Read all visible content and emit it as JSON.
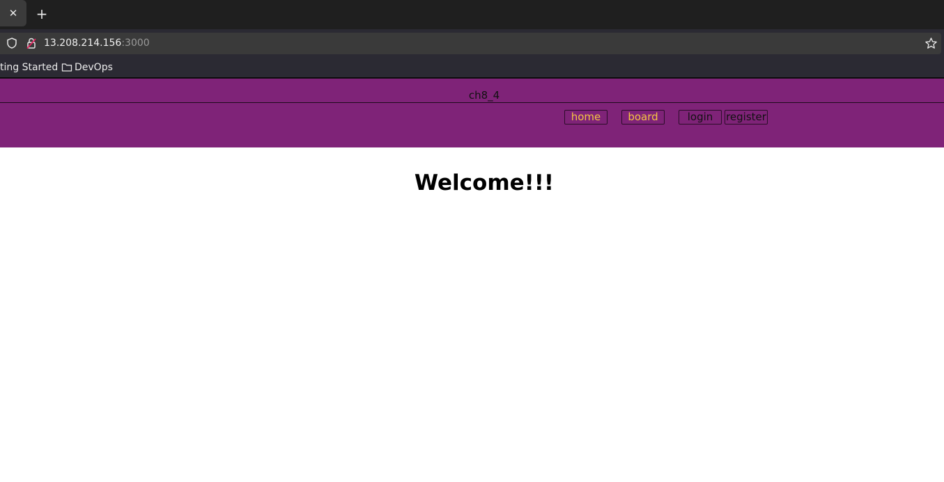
{
  "browser": {
    "tab_close_glyph": "✕",
    "new_tab_glyph": "+",
    "url_host": "13.208.214.156",
    "url_port": ":3000",
    "bookmarks": [
      {
        "label": "ting Started",
        "icon": "none"
      },
      {
        "label": "DevOps",
        "icon": "folder-icon"
      }
    ]
  },
  "site": {
    "title": "ch8_4",
    "nav": {
      "home": "home",
      "board": "board",
      "login": "login",
      "register": "register"
    },
    "heading": "Welcome!!!"
  },
  "colors": {
    "header_bg": "#7f2378",
    "nav_link_active": "#f4c542",
    "nav_link_default": "#111111"
  }
}
